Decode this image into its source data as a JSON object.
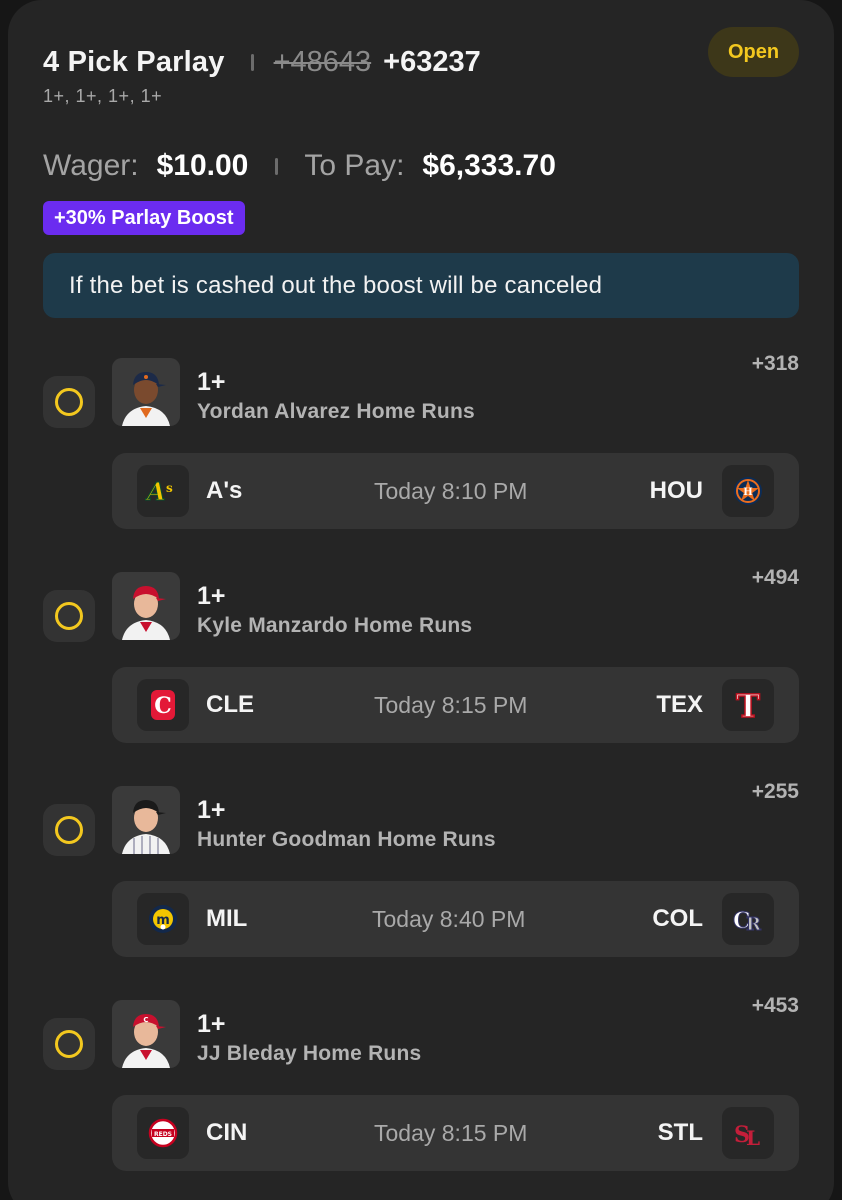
{
  "header": {
    "title": "4 Pick Parlay",
    "old_odds": "+48643",
    "new_odds": "+63237",
    "subtitle": "1+, 1+, 1+, 1+",
    "status": "Open"
  },
  "wager": {
    "label": "Wager:",
    "value": "$10.00"
  },
  "payout": {
    "label": "To Pay:",
    "value": "$6,333.70"
  },
  "boost": {
    "label": "+30% Parlay Boost"
  },
  "notice": {
    "text": "If the bet is cashed out the boost will be canceled"
  },
  "legs": [
    {
      "line": "1+",
      "market": "Yordan Alvarez Home Runs",
      "odds": "+318",
      "away": "A's",
      "home": "HOU",
      "time": "Today 8:10 PM",
      "away_icon": "athletics-logo-icon",
      "home_icon": "astros-logo-icon"
    },
    {
      "line": "1+",
      "market": "Kyle Manzardo Home Runs",
      "odds": "+494",
      "away": "CLE",
      "home": "TEX",
      "time": "Today 8:15 PM",
      "away_icon": "guardians-logo-icon",
      "home_icon": "rangers-logo-icon"
    },
    {
      "line": "1+",
      "market": "Hunter Goodman Home Runs",
      "odds": "+255",
      "away": "MIL",
      "home": "COL",
      "time": "Today 8:40 PM",
      "away_icon": "brewers-logo-icon",
      "home_icon": "rockies-logo-icon"
    },
    {
      "line": "1+",
      "market": "JJ Bleday Home Runs",
      "odds": "+453",
      "away": "CIN",
      "home": "STL",
      "time": "Today 8:15 PM",
      "away_icon": "reds-logo-icon",
      "home_icon": "cardinals-logo-icon"
    }
  ],
  "colors": {
    "card_bg": "#252525",
    "accent_yellow": "#f3c81f",
    "boost_purple": "#6b2cf0",
    "notice_bg": "#1e3a4a"
  }
}
